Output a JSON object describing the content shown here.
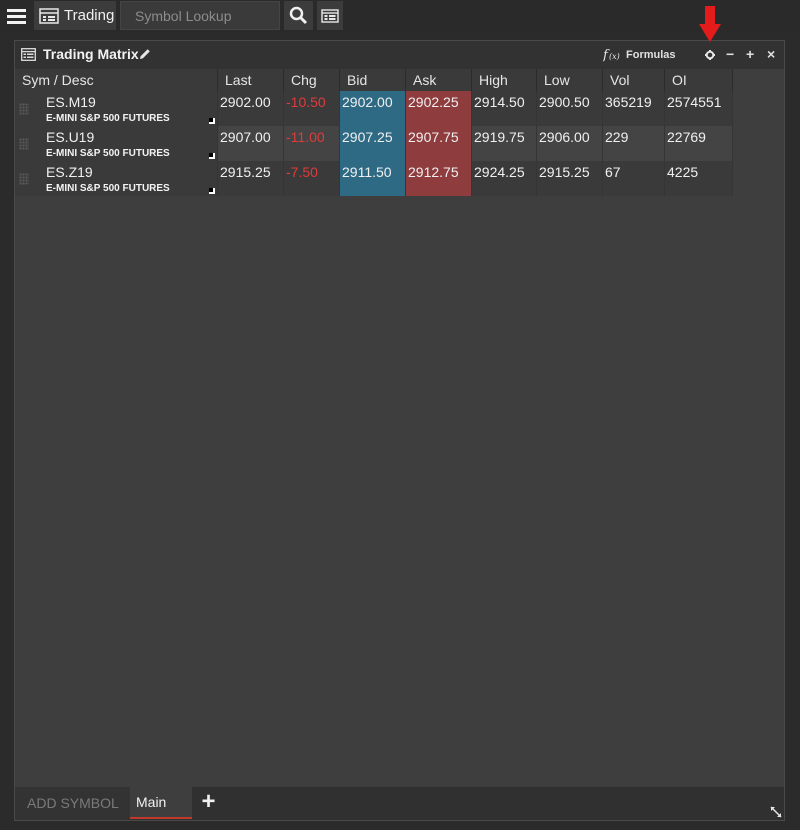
{
  "toolbar": {
    "trading_label": "Trading",
    "search_placeholder": "Symbol Lookup"
  },
  "panel": {
    "title": "Trading Matrix",
    "formulas_label": "Formulas",
    "controls": {
      "minimize": "−",
      "maximize": "+",
      "close": "×"
    }
  },
  "grid": {
    "columns": [
      "Sym / Desc",
      "Last",
      "Chg",
      "Bid",
      "Ask",
      "High",
      "Low",
      "Vol",
      "OI"
    ],
    "rows": [
      {
        "symbol": "ES.M19",
        "desc": "E-MINI S&P 500 FUTURES",
        "last": "2902.00",
        "chg": "-10.50",
        "bid": "2902.00",
        "ask": "2902.25",
        "high": "2914.50",
        "low": "2900.50",
        "vol": "365219",
        "oi": "2574551"
      },
      {
        "symbol": "ES.U19",
        "desc": "E-MINI S&P 500 FUTURES",
        "last": "2907.00",
        "chg": "-11.00",
        "bid": "2907.25",
        "ask": "2907.75",
        "high": "2919.75",
        "low": "2906.00",
        "vol": "229",
        "oi": "22769"
      },
      {
        "symbol": "ES.Z19",
        "desc": "E-MINI S&P 500 FUTURES",
        "last": "2915.25",
        "chg": "-7.50",
        "bid": "2911.50",
        "ask": "2912.75",
        "high": "2924.25",
        "low": "2915.25",
        "vol": "67",
        "oi": "4225"
      }
    ]
  },
  "tabs": {
    "add_symbol": "ADD SYMBOL",
    "main": "Main",
    "add": "+"
  },
  "colors": {
    "bid_bg": "#2f6a85",
    "ask_bg": "#8f3c3e",
    "negative": "#e03a3a",
    "annotation_arrow": "#e31b1b"
  },
  "icons": [
    "menu-icon",
    "trading-icon",
    "search-icon",
    "dom-icon",
    "grid-icon",
    "pencil-icon",
    "formula-icon",
    "gear-icon",
    "resize-icon",
    "arrow-down-icon"
  ]
}
